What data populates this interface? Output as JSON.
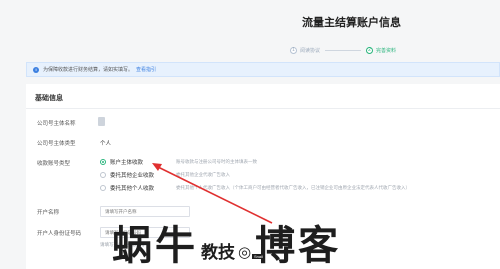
{
  "page": {
    "title": "流量主结算账户信息"
  },
  "steps": [
    {
      "index": "1",
      "label": "阅读协议",
      "active": false
    },
    {
      "index": "2",
      "label": "完善资料",
      "active": true
    }
  ],
  "notice": {
    "text": "为保障收款进行财务结算，请如实填写。",
    "link": "查看指引"
  },
  "section": {
    "title": "基础信息"
  },
  "form": {
    "company_name_label": "公司号主体名称",
    "company_type_label": "公司号主体类型",
    "company_type_value": "个人",
    "account_type_label": "收款账号类型",
    "options": [
      {
        "label": "账户主体收款",
        "desc": "账号收款与注册公司号时的主体填表一致",
        "checked": true
      },
      {
        "label": "委托其他企业收款",
        "desc": "委托其他企业代收广告收入",
        "checked": false
      },
      {
        "label": "委托其他个人收款",
        "desc": "委托其他个人代收广告收入（个体工商户可由经营者代收广告收入，已注销企业可由原企业法定代表人代收广告收入）",
        "checked": false
      }
    ],
    "account_name_label": "开户名称",
    "account_name_placeholder": "请填写开户名称",
    "id_label": "开户人身份证号码",
    "id_placeholder": "请填写身份证号码",
    "hint": "请填写开户人身份证号"
  },
  "watermark": {
    "big_left": "蜗牛",
    "small_middle": "教技",
    "snail_icon": "snail-icon",
    "big_right": "博客",
    "url": "Snail"
  },
  "colors": {
    "accent": "#2ab57d",
    "link": "#3b7fe0",
    "arrow": "#e03030"
  }
}
